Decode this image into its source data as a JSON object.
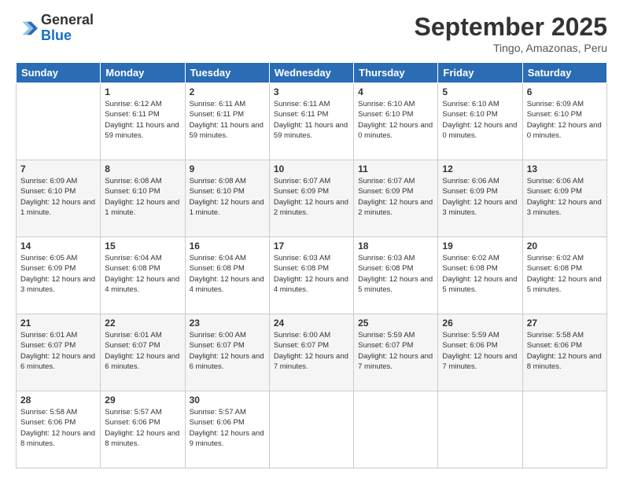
{
  "header": {
    "logo_general": "General",
    "logo_blue": "Blue",
    "month_title": "September 2025",
    "location": "Tingo, Amazonas, Peru"
  },
  "days_of_week": [
    "Sunday",
    "Monday",
    "Tuesday",
    "Wednesday",
    "Thursday",
    "Friday",
    "Saturday"
  ],
  "weeks": [
    [
      {
        "day": "",
        "info": ""
      },
      {
        "day": "1",
        "info": "Sunrise: 6:12 AM\nSunset: 6:11 PM\nDaylight: 11 hours\nand 59 minutes."
      },
      {
        "day": "2",
        "info": "Sunrise: 6:11 AM\nSunset: 6:11 PM\nDaylight: 11 hours\nand 59 minutes."
      },
      {
        "day": "3",
        "info": "Sunrise: 6:11 AM\nSunset: 6:11 PM\nDaylight: 11 hours\nand 59 minutes."
      },
      {
        "day": "4",
        "info": "Sunrise: 6:10 AM\nSunset: 6:10 PM\nDaylight: 12 hours\nand 0 minutes."
      },
      {
        "day": "5",
        "info": "Sunrise: 6:10 AM\nSunset: 6:10 PM\nDaylight: 12 hours\nand 0 minutes."
      },
      {
        "day": "6",
        "info": "Sunrise: 6:09 AM\nSunset: 6:10 PM\nDaylight: 12 hours\nand 0 minutes."
      }
    ],
    [
      {
        "day": "7",
        "info": "Sunrise: 6:09 AM\nSunset: 6:10 PM\nDaylight: 12 hours\nand 1 minute."
      },
      {
        "day": "8",
        "info": "Sunrise: 6:08 AM\nSunset: 6:10 PM\nDaylight: 12 hours\nand 1 minute."
      },
      {
        "day": "9",
        "info": "Sunrise: 6:08 AM\nSunset: 6:10 PM\nDaylight: 12 hours\nand 1 minute."
      },
      {
        "day": "10",
        "info": "Sunrise: 6:07 AM\nSunset: 6:09 PM\nDaylight: 12 hours\nand 2 minutes."
      },
      {
        "day": "11",
        "info": "Sunrise: 6:07 AM\nSunset: 6:09 PM\nDaylight: 12 hours\nand 2 minutes."
      },
      {
        "day": "12",
        "info": "Sunrise: 6:06 AM\nSunset: 6:09 PM\nDaylight: 12 hours\nand 3 minutes."
      },
      {
        "day": "13",
        "info": "Sunrise: 6:06 AM\nSunset: 6:09 PM\nDaylight: 12 hours\nand 3 minutes."
      }
    ],
    [
      {
        "day": "14",
        "info": "Sunrise: 6:05 AM\nSunset: 6:09 PM\nDaylight: 12 hours\nand 3 minutes."
      },
      {
        "day": "15",
        "info": "Sunrise: 6:04 AM\nSunset: 6:08 PM\nDaylight: 12 hours\nand 4 minutes."
      },
      {
        "day": "16",
        "info": "Sunrise: 6:04 AM\nSunset: 6:08 PM\nDaylight: 12 hours\nand 4 minutes."
      },
      {
        "day": "17",
        "info": "Sunrise: 6:03 AM\nSunset: 6:08 PM\nDaylight: 12 hours\nand 4 minutes."
      },
      {
        "day": "18",
        "info": "Sunrise: 6:03 AM\nSunset: 6:08 PM\nDaylight: 12 hours\nand 5 minutes."
      },
      {
        "day": "19",
        "info": "Sunrise: 6:02 AM\nSunset: 6:08 PM\nDaylight: 12 hours\nand 5 minutes."
      },
      {
        "day": "20",
        "info": "Sunrise: 6:02 AM\nSunset: 6:08 PM\nDaylight: 12 hours\nand 5 minutes."
      }
    ],
    [
      {
        "day": "21",
        "info": "Sunrise: 6:01 AM\nSunset: 6:07 PM\nDaylight: 12 hours\nand 6 minutes."
      },
      {
        "day": "22",
        "info": "Sunrise: 6:01 AM\nSunset: 6:07 PM\nDaylight: 12 hours\nand 6 minutes."
      },
      {
        "day": "23",
        "info": "Sunrise: 6:00 AM\nSunset: 6:07 PM\nDaylight: 12 hours\nand 6 minutes."
      },
      {
        "day": "24",
        "info": "Sunrise: 6:00 AM\nSunset: 6:07 PM\nDaylight: 12 hours\nand 7 minutes."
      },
      {
        "day": "25",
        "info": "Sunrise: 5:59 AM\nSunset: 6:07 PM\nDaylight: 12 hours\nand 7 minutes."
      },
      {
        "day": "26",
        "info": "Sunrise: 5:59 AM\nSunset: 6:06 PM\nDaylight: 12 hours\nand 7 minutes."
      },
      {
        "day": "27",
        "info": "Sunrise: 5:58 AM\nSunset: 6:06 PM\nDaylight: 12 hours\nand 8 minutes."
      }
    ],
    [
      {
        "day": "28",
        "info": "Sunrise: 5:58 AM\nSunset: 6:06 PM\nDaylight: 12 hours\nand 8 minutes."
      },
      {
        "day": "29",
        "info": "Sunrise: 5:57 AM\nSunset: 6:06 PM\nDaylight: 12 hours\nand 8 minutes."
      },
      {
        "day": "30",
        "info": "Sunrise: 5:57 AM\nSunset: 6:06 PM\nDaylight: 12 hours\nand 9 minutes."
      },
      {
        "day": "",
        "info": ""
      },
      {
        "day": "",
        "info": ""
      },
      {
        "day": "",
        "info": ""
      },
      {
        "day": "",
        "info": ""
      }
    ]
  ]
}
